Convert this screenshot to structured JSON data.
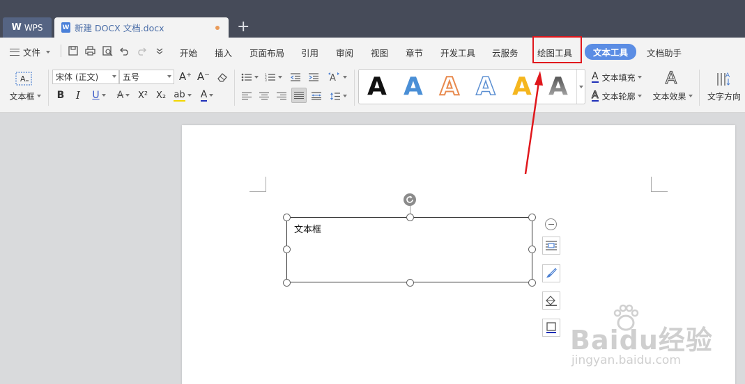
{
  "tabs": {
    "wps_logo": "W",
    "wps_label": "WPS",
    "doc_icon": "W",
    "doc_name": "新建 DOCX 文档.docx",
    "add": "+"
  },
  "menu": {
    "file": "文件",
    "items": [
      "开始",
      "插入",
      "页面布局",
      "引用",
      "审阅",
      "视图",
      "章节",
      "开发工具",
      "云服务",
      "绘图工具",
      "文本工具",
      "文档助手"
    ],
    "active": "文本工具",
    "highlighted": "绘图工具"
  },
  "ribbon": {
    "textbox_label": "文本框",
    "font_name": "宋体 (正文)",
    "font_size": "五号",
    "grow_font": "A⁺",
    "shrink_font": "A⁻",
    "bold": "B",
    "italic": "I",
    "underline": "U",
    "strike": "A",
    "superscript": "X²",
    "subscript": "X₂",
    "highlight": "ab",
    "font_color": "A",
    "art_letter": "A",
    "text_fill": "文本填充",
    "text_outline": "文本轮廓",
    "text_effect": "文本效果",
    "text_direction": "文字方向",
    "art_colors": [
      "#111111",
      "#4a8fd6",
      "#e88a4e",
      "#5b8fd2",
      "#f5b61e",
      "#7a7a7a"
    ]
  },
  "document": {
    "textbox_text": "文本框"
  },
  "watermark": {
    "main": "Baidu经验",
    "sub": "jingyan.baidu.com"
  },
  "colors": {
    "accent": "#5b8de4",
    "annotation": "#e0171c"
  }
}
